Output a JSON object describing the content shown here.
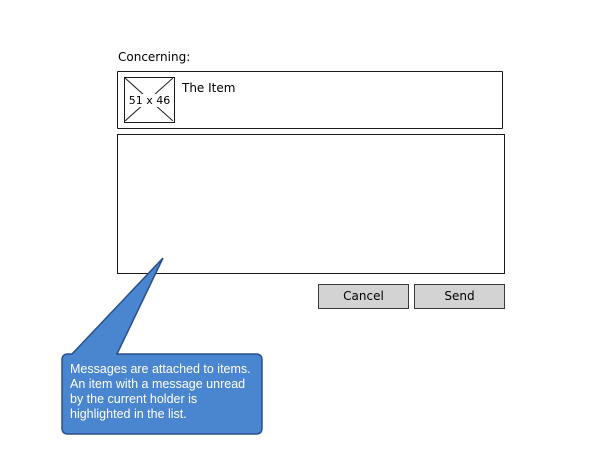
{
  "form": {
    "concerning_label": "Concerning:",
    "item": {
      "thumbnail_label": "51 x 46",
      "title": "The Item"
    },
    "message_value": "",
    "buttons": {
      "cancel_label": "Cancel",
      "send_label": "Send"
    }
  },
  "annotation": {
    "text": "Messages are attached to items. An item with a message unread by the current holder is highlighted in the list.",
    "fill_color": "#4a86cf",
    "border_color": "#2a4f8a"
  },
  "colors": {
    "button_bg": "#d3d3d3",
    "outline": "#1a1a1a"
  }
}
